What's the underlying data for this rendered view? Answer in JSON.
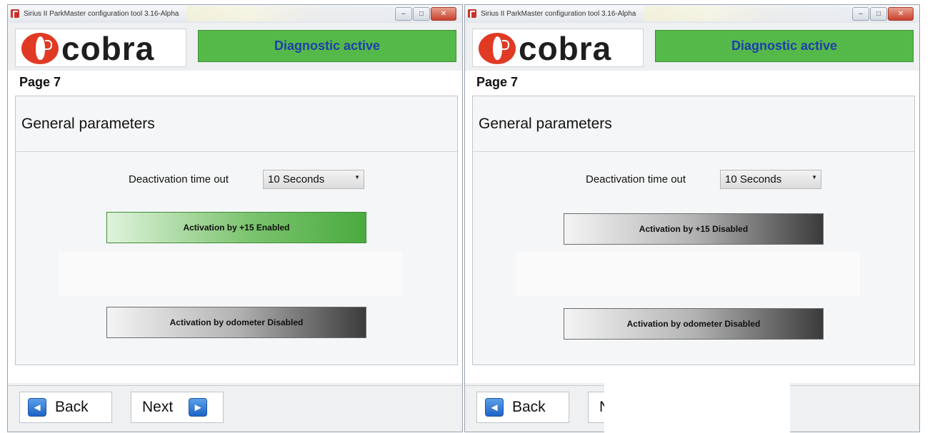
{
  "windows": [
    {
      "title": "Sirius II ParkMaster configuration tool  3.16-Alpha",
      "logo_text": "cobra",
      "status_banner": "Diagnostic active",
      "page_label": "Page 7",
      "section_title": "General parameters",
      "timeout": {
        "label": "Deactivation time out",
        "value": "10 Seconds"
      },
      "plus15_button": {
        "label": "Activation by +15 Enabled",
        "state": "enabled"
      },
      "odometer_button": {
        "label": "Activation by odometer Disabled",
        "state": "disabled"
      },
      "nav": {
        "back_label": "Back",
        "next_label": "Next"
      }
    },
    {
      "title": "Sirius II ParkMaster configuration tool  3.16-Alpha",
      "logo_text": "cobra",
      "status_banner": "Diagnostic active",
      "page_label": "Page 7",
      "section_title": "General parameters",
      "timeout": {
        "label": "Deactivation time out",
        "value": "10 Seconds"
      },
      "plus15_button": {
        "label": "Activation by +15 Disabled",
        "state": "disabled"
      },
      "odometer_button": {
        "label": "Activation by odometer Disabled",
        "state": "disabled"
      },
      "nav": {
        "back_label": "Back",
        "next_label": "N"
      }
    }
  ],
  "icons": {
    "back": "arrow-left-icon",
    "next": "arrow-right-icon",
    "dropdown": "chevron-down-icon",
    "minimize": "minimize-icon",
    "maximize": "maximize-icon",
    "close": "close-icon"
  },
  "colors": {
    "status_green": "#54b948",
    "status_text_blue": "#1f3fae",
    "enabled_green": "#49ab3e",
    "disabled_dark": "#3b3b3b",
    "logo_red": "#e03a24",
    "nav_icon_blue": "#1e63c6"
  }
}
